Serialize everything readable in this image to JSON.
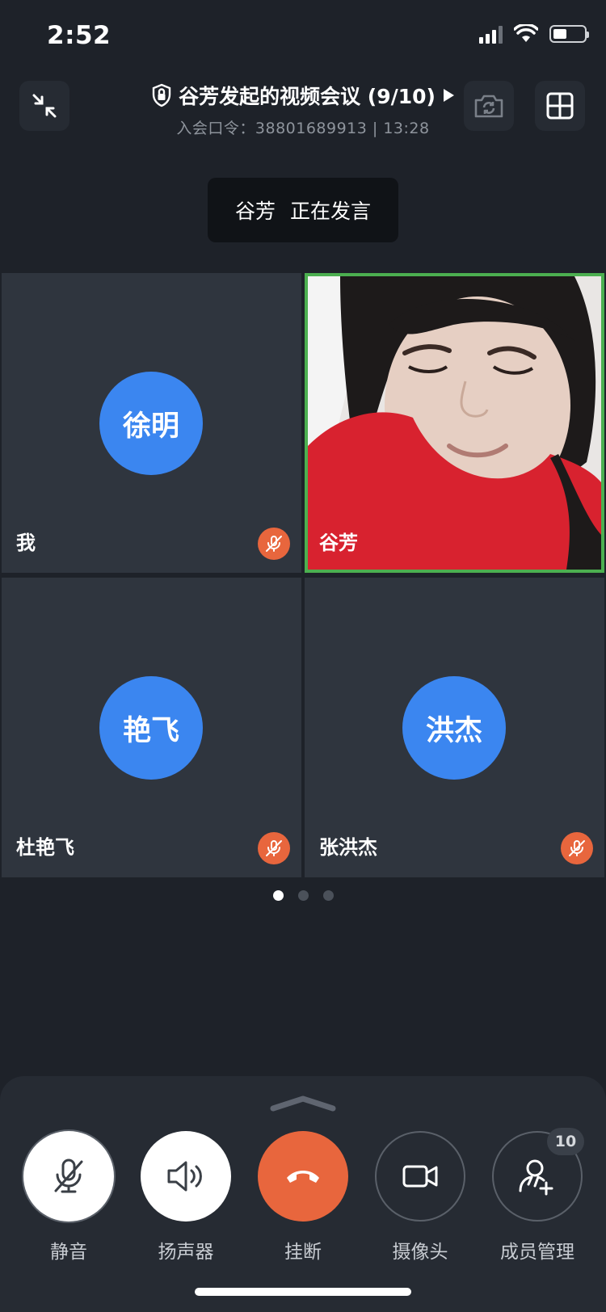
{
  "status_bar": {
    "time": "2:52",
    "battery_level": 0.45
  },
  "header": {
    "title": "谷芳发起的视频会议 (9/10)",
    "subtitle": "入会口令：38801689913 | 13:28",
    "icons": [
      "minimize-icon",
      "lock-shield-icon",
      "play-arrow-icon",
      "switch-camera-icon",
      "grid-layout-icon"
    ]
  },
  "speaking": {
    "name": "谷芳",
    "status": "正在发言"
  },
  "participants": [
    {
      "avatar_text": "徐明",
      "name": "我",
      "muted": true,
      "video": false
    },
    {
      "avatar_text": "",
      "name": "谷芳",
      "muted": false,
      "video": true,
      "active_speaker": true
    },
    {
      "avatar_text": "艳飞",
      "name": "杜艳飞",
      "muted": true,
      "video": false
    },
    {
      "avatar_text": "洪杰",
      "name": "张洪杰",
      "muted": true,
      "video": false
    }
  ],
  "pager": {
    "pages": 3,
    "current": 1
  },
  "controls": {
    "mute_label": "静音",
    "speaker_label": "扬声器",
    "hangup_label": "挂断",
    "camera_label": "摄像头",
    "members_label": "成员管理",
    "members_count": "10"
  },
  "colors": {
    "accent_blue": "#3b86f0",
    "hangup_red": "#e8663d",
    "active_green": "#4caf50",
    "background": "#1e2229"
  }
}
